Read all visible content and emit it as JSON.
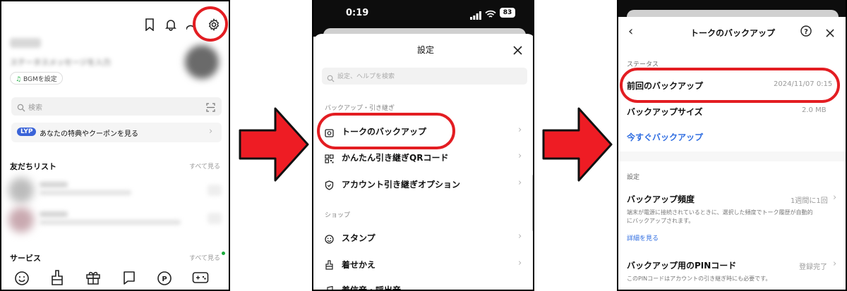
{
  "panel1": {
    "status_message_placeholder": "ステータスメッセージを入力",
    "bgm_label": "BGMを設定",
    "search_placeholder": "検索",
    "lyp_badge": "LYP",
    "lyp_banner_text": "あなたの特典やクーポンを見る",
    "friends_title": "友だちリスト",
    "friends_see_all": "すべて見る",
    "services_title": "サービス",
    "services_see_all": "すべて見る",
    "header_icons": [
      "bookmark-icon",
      "bell-icon",
      "add-friend-icon",
      "gear-icon"
    ],
    "service_icons": [
      "smiley-icon",
      "brush-icon",
      "gift-icon",
      "chat-icon",
      "points-icon",
      "game-icon"
    ]
  },
  "panel2": {
    "time": "0:19",
    "battery": "83",
    "title": "設定",
    "search_placeholder": "設定、ヘルプを検索",
    "section_backup": "バックアップ・引き継ぎ",
    "items": [
      {
        "label": "トークのバックアップ",
        "icon": "backup-icon"
      },
      {
        "label": "かんたん引き継ぎQRコード",
        "icon": "qr-icon"
      },
      {
        "label": "アカウント引き継ぎオプション",
        "icon": "shield-icon"
      }
    ],
    "section_shop": "ショップ",
    "shop_items": [
      {
        "label": "スタンプ",
        "icon": "smiley-icon"
      },
      {
        "label": "着せかえ",
        "icon": "brush-icon"
      },
      {
        "label": "着信音・呼出音",
        "icon": "music-icon"
      }
    ]
  },
  "panel3": {
    "title": "トークのバックアップ",
    "status_section": "ステータス",
    "last_backup_label": "前回のバックアップ",
    "last_backup_value": "2024/11/07 0:15",
    "backup_size_label": "バックアップサイズ",
    "backup_size_value": "2.0 MB",
    "backup_now": "今すぐバックアップ",
    "settings_section": "設定",
    "frequency_label": "バックアップ頻度",
    "frequency_value": "1週間に1回",
    "frequency_desc_1": "端末が電源に接続されているときに、選択した頻度でトーク履歴が自動的",
    "frequency_desc_2": "にバックアップされます。",
    "details_link": "詳細を見る",
    "pin_label": "バックアップ用のPINコード",
    "pin_value": "登録完了",
    "pin_desc": "このPINコードはアカウントの引き継ぎ時にも必要です。"
  },
  "colors": {
    "highlight": "#e31d22",
    "link": "#2f6de1",
    "lyp": "#3b64d8"
  }
}
